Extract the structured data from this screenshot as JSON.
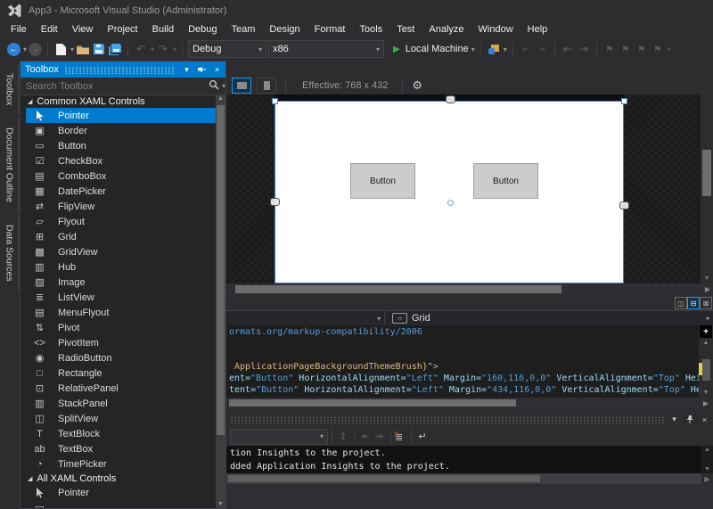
{
  "window": {
    "title": "App3 - Microsoft Visual Studio (Administrator)"
  },
  "menu": {
    "items": [
      "File",
      "Edit",
      "View",
      "Project",
      "Build",
      "Debug",
      "Team",
      "Design",
      "Format",
      "Tools",
      "Test",
      "Analyze",
      "Window",
      "Help"
    ]
  },
  "toolbar": {
    "debug_config": "Debug",
    "platform": "x86",
    "run_target": "Local Machine"
  },
  "side_tabs": [
    "Toolbox",
    "Document Outline",
    "Data Sources"
  ],
  "toolbox": {
    "title": "Toolbox",
    "search_placeholder": "Search Toolbox",
    "sections": [
      {
        "label": "Common XAML Controls",
        "items": [
          {
            "label": "Pointer",
            "icon": "pointer-icon",
            "glyph": "svg-pointer",
            "selected": true
          },
          {
            "label": "Border",
            "icon": "border-icon",
            "glyph": "▣"
          },
          {
            "label": "Button",
            "icon": "button-icon",
            "glyph": "▭"
          },
          {
            "label": "CheckBox",
            "icon": "checkbox-icon",
            "glyph": "☑"
          },
          {
            "label": "ComboBox",
            "icon": "combobox-icon",
            "glyph": "▤"
          },
          {
            "label": "DatePicker",
            "icon": "datepicker-icon",
            "glyph": "▦"
          },
          {
            "label": "FlipView",
            "icon": "flipview-icon",
            "glyph": "⇄"
          },
          {
            "label": "Flyout",
            "icon": "flyout-icon",
            "glyph": "▱"
          },
          {
            "label": "Grid",
            "icon": "grid-icon",
            "glyph": "⊞"
          },
          {
            "label": "GridView",
            "icon": "gridview-icon",
            "glyph": "▩"
          },
          {
            "label": "Hub",
            "icon": "hub-icon",
            "glyph": "▥"
          },
          {
            "label": "Image",
            "icon": "image-icon",
            "glyph": "▨"
          },
          {
            "label": "ListView",
            "icon": "listview-icon",
            "glyph": "≣"
          },
          {
            "label": "MenuFlyout",
            "icon": "menuflyout-icon",
            "glyph": "▤"
          },
          {
            "label": "Pivot",
            "icon": "pivot-icon",
            "glyph": "⇅"
          },
          {
            "label": "PivotItem",
            "icon": "pivotitem-icon",
            "glyph": "<>"
          },
          {
            "label": "RadioButton",
            "icon": "radiobutton-icon",
            "glyph": "◉"
          },
          {
            "label": "Rectangle",
            "icon": "rectangle-icon",
            "glyph": "□"
          },
          {
            "label": "RelativePanel",
            "icon": "relativepanel-icon",
            "glyph": "⊡"
          },
          {
            "label": "StackPanel",
            "icon": "stackpanel-icon",
            "glyph": "▥"
          },
          {
            "label": "SplitView",
            "icon": "splitview-icon",
            "glyph": "◫"
          },
          {
            "label": "TextBlock",
            "icon": "textblock-icon",
            "glyph": "T"
          },
          {
            "label": "TextBox",
            "icon": "textbox-icon",
            "glyph": "ab"
          },
          {
            "label": "TimePicker",
            "icon": "timepicker-icon",
            "glyph": "◔"
          }
        ]
      },
      {
        "label": "All XAML Controls",
        "items": [
          {
            "label": "Pointer",
            "icon": "pointer-icon",
            "glyph": "svg-pointer"
          },
          {
            "label": "",
            "icon": "partial-item-icon",
            "glyph": "▭"
          }
        ]
      }
    ]
  },
  "designer": {
    "effective_label": "Effective: 768 x 432",
    "canvas_buttons": [
      "Button",
      "Button"
    ]
  },
  "breadcrumb": {
    "node": "Grid"
  },
  "code": {
    "lines": [
      {
        "segments": [
          {
            "t": "ormats.org/markup-compatibility/2006",
            "c": "val"
          }
        ]
      },
      {
        "segments": []
      },
      {
        "segments": []
      },
      {
        "segments": [
          {
            "t": " ApplicationPageBackgroundThemeBrush}",
            "c": "brush"
          },
          {
            "t": "\">",
            "c": "punct"
          }
        ]
      },
      {
        "segments": [
          {
            "t": "ent=",
            "c": "attr"
          },
          {
            "t": "\"Button\"",
            "c": "val"
          },
          {
            "t": " ",
            "c": "plain"
          },
          {
            "t": "HorizontalAlignment=",
            "c": "attr"
          },
          {
            "t": "\"Left\"",
            "c": "val"
          },
          {
            "t": " ",
            "c": "plain"
          },
          {
            "t": "Margin=",
            "c": "attr"
          },
          {
            "t": "\"160,116,0,0\"",
            "c": "val"
          },
          {
            "t": " ",
            "c": "plain"
          },
          {
            "t": "VerticalAlignment=",
            "c": "attr"
          },
          {
            "t": "\"Top\"",
            "c": "val"
          },
          {
            "t": " ",
            "c": "plain"
          },
          {
            "t": "Height=",
            "c": "attr"
          }
        ]
      },
      {
        "segments": [
          {
            "t": "tent=",
            "c": "attr"
          },
          {
            "t": "\"Button\"",
            "c": "val"
          },
          {
            "t": " ",
            "c": "plain"
          },
          {
            "t": "HorizontalAlignment=",
            "c": "attr"
          },
          {
            "t": "\"Left\"",
            "c": "val"
          },
          {
            "t": " ",
            "c": "plain"
          },
          {
            "t": "Margin=",
            "c": "attr"
          },
          {
            "t": "\"434,116,0,0\"",
            "c": "val"
          },
          {
            "t": " ",
            "c": "plain"
          },
          {
            "t": "VerticalAlignment=",
            "c": "attr"
          },
          {
            "t": "\"Top\"",
            "c": "val"
          },
          {
            "t": " ",
            "c": "plain"
          },
          {
            "t": "Height",
            "c": "attr"
          }
        ]
      }
    ]
  },
  "output": {
    "lines": [
      "tion Insights to the project.",
      "dded Application Insights to the project."
    ]
  },
  "colors": {
    "accent_blue": "#007acc",
    "run_green": "#3db24a",
    "selection_border": "#3f7fbf",
    "modified_marker_yellow": "#e0cf4e",
    "folder_gold": "#dcb67a",
    "save_blue": "#45a5e6",
    "canvas_button_gray": "#cccccc",
    "editor_background": "#1e1e1e"
  }
}
